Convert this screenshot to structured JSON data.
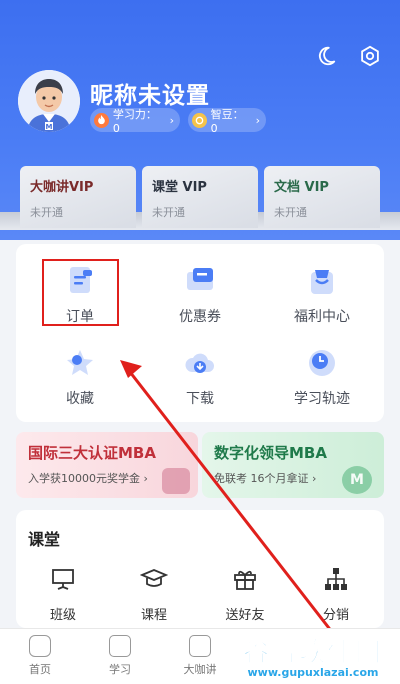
{
  "header": {
    "nickname": "昵称未设置"
  },
  "stats": [
    {
      "label": "学习力：0"
    },
    {
      "label": "智豆：0"
    }
  ],
  "vip_cards": [
    {
      "title": "大咖讲VIP",
      "status": "未开通",
      "color": "#7a2a2a"
    },
    {
      "title": "课堂 VIP",
      "status": "未开通",
      "color": "#2b3340"
    },
    {
      "title": "文档 VIP",
      "status": "未开通",
      "color": "#2a6a4a"
    }
  ],
  "quick_menu": [
    {
      "label": "订单",
      "icon": "order-icon"
    },
    {
      "label": "优惠券",
      "icon": "coupon-icon"
    },
    {
      "label": "福利中心",
      "icon": "gift-bag-icon"
    },
    {
      "label": "收藏",
      "icon": "star-icon"
    },
    {
      "label": "下载",
      "icon": "download-cloud-icon"
    },
    {
      "label": "学习轨迹",
      "icon": "clock-icon"
    }
  ],
  "banners": [
    {
      "title": "国际三大认证MBA",
      "subtitle": "入学获10000元奖学金",
      "title_color": "#c0303a"
    },
    {
      "title": "数字化领导MBA",
      "subtitle": "免联考  16个月拿证",
      "title_color": "#1f7a4a"
    }
  ],
  "classroom": {
    "title": "课堂",
    "items": [
      {
        "label": "班级",
        "icon": "easel-icon"
      },
      {
        "label": "课程",
        "icon": "graduation-cap-icon"
      },
      {
        "label": "送好友",
        "icon": "gift-icon"
      },
      {
        "label": "分销",
        "icon": "org-chart-icon"
      }
    ]
  },
  "tabs": [
    {
      "label": "首页",
      "icon": "home-icon"
    },
    {
      "label": "学习",
      "icon": "book-icon"
    },
    {
      "label": "大咖讲",
      "icon": "audio-icon"
    }
  ],
  "watermark": {
    "title": "谷普软件园",
    "url": "www.gupuxlazai.com"
  }
}
